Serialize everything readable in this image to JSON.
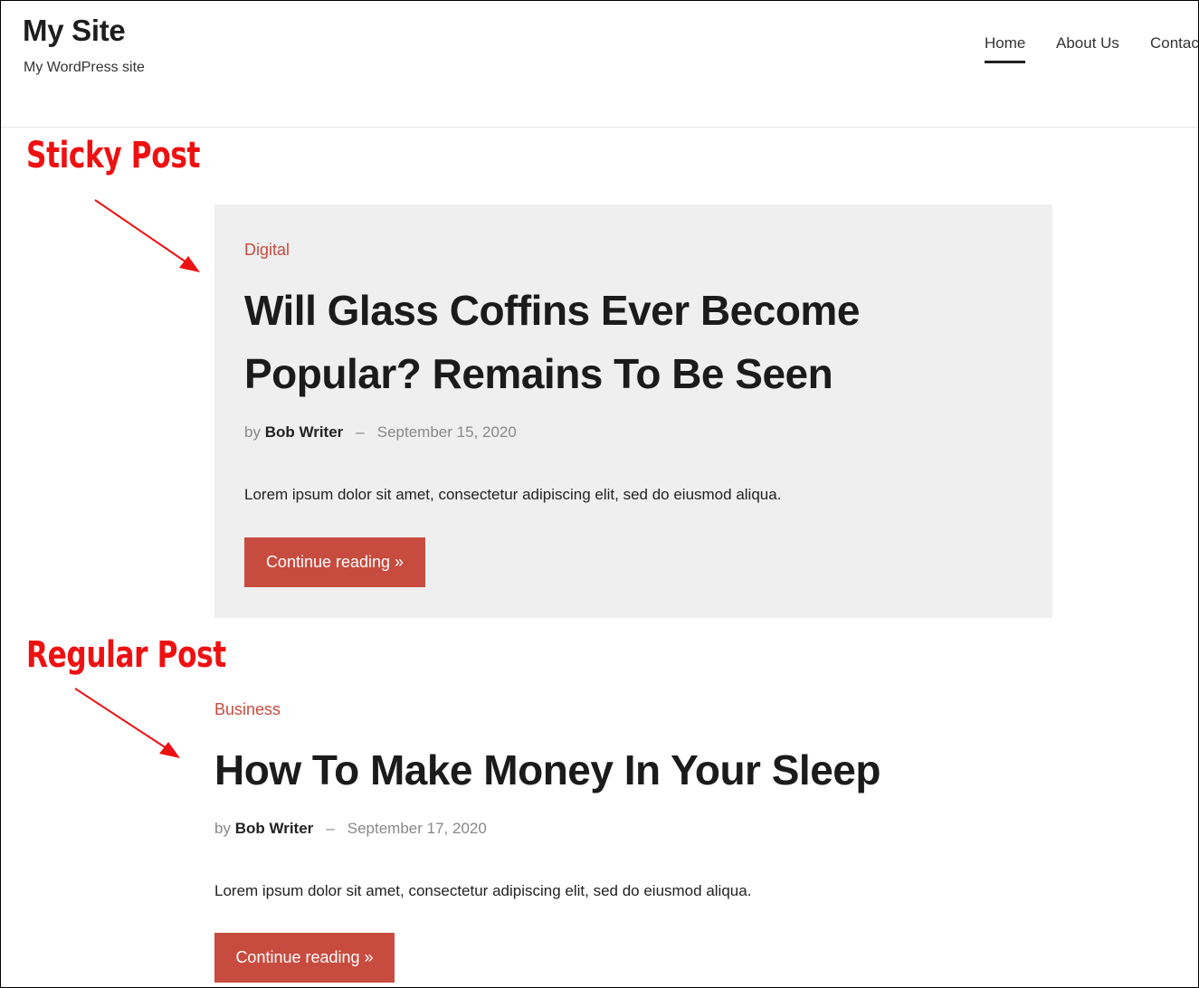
{
  "site": {
    "title": "My Site",
    "tagline": "My WordPress site"
  },
  "nav": {
    "items": [
      {
        "label": "Home",
        "active": true
      },
      {
        "label": "About Us",
        "active": false
      },
      {
        "label": "Contac",
        "active": false
      }
    ]
  },
  "annotations": {
    "sticky_label": "Sticky Post",
    "regular_label": "Regular Post",
    "color": "#ee1111"
  },
  "posts": [
    {
      "category": "Digital",
      "title": "Will Glass Coffins Ever Become Popular? Remains To Be Seen",
      "by": "by",
      "author": "Bob Writer",
      "separator": "–",
      "date": "September 15, 2020",
      "excerpt": "Lorem ipsum dolor sit amet, consectetur adipiscing elit, sed do eiusmod aliqua.",
      "button_label": "Continue reading »",
      "sticky": true
    },
    {
      "category": "Business",
      "title": "How To Make Money In Your Sleep",
      "by": "by",
      "author": "Bob Writer",
      "separator": "–",
      "date": "September 17, 2020",
      "excerpt": "Lorem ipsum dolor sit amet, consectetur adipiscing elit, sed do eiusmod aliqua.",
      "button_label": "Continue reading »",
      "sticky": false
    }
  ],
  "colors": {
    "accent": "#c74b3e",
    "sticky_background": "#efefef",
    "annotation": "#ee1111"
  },
  "icons": {
    "annotation_arrow": "arrow-icon"
  }
}
